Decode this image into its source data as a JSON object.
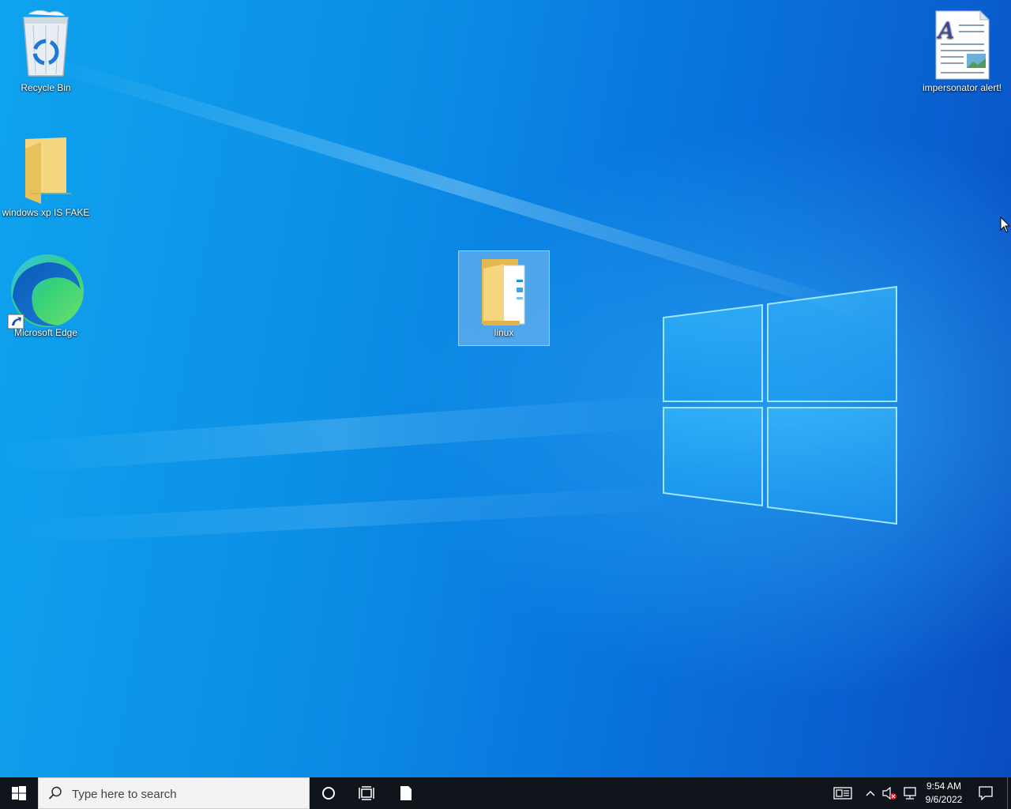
{
  "desktop": {
    "icons": [
      {
        "label": "Recycle Bin"
      },
      {
        "label": "windows xp IS FAKE"
      },
      {
        "label": "Microsoft Edge"
      },
      {
        "label": "linux"
      },
      {
        "label": "impersonator alert!"
      }
    ]
  },
  "taskbar": {
    "search_placeholder": "Type here to search",
    "clock": {
      "time": "9:54 AM",
      "date": "9/6/2022"
    }
  },
  "colors": {
    "desktop_accent": "#0c8fe6",
    "taskbar_bg": "#10151c",
    "selection": "#a0cdf5"
  },
  "icons_semantic": [
    "windows-start-icon",
    "search-icon",
    "cortana-icon",
    "task-view-icon",
    "file-icon",
    "news-icon",
    "chevron-up-icon",
    "volume-muted-icon",
    "network-icon",
    "notification-icon"
  ]
}
